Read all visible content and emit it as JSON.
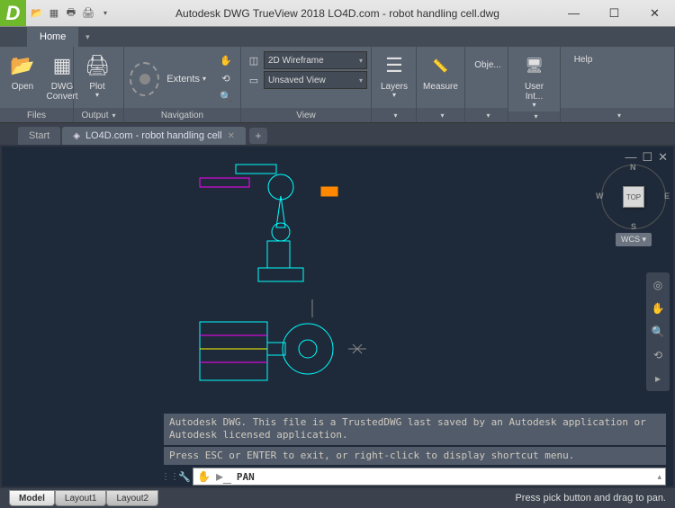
{
  "title": "Autodesk DWG TrueView 2018     LO4D.com - robot handling cell.dwg",
  "ribbon_tabs": [
    "Home"
  ],
  "panels": {
    "files": {
      "title": "Files",
      "open": "Open",
      "convert": "DWG\nConvert"
    },
    "output": {
      "title": "Output",
      "plot": "Plot"
    },
    "navigation": {
      "title": "Navigation",
      "extents": "Extents"
    },
    "view": {
      "title": "View",
      "visual_style": "2D Wireframe",
      "named_view": "Unsaved View"
    },
    "layers": {
      "title": "",
      "label": "Layers"
    },
    "measure": {
      "title": "",
      "label": "Measure"
    },
    "objects": {
      "title": "",
      "label": "Obje..."
    },
    "ui": {
      "title": "",
      "label": "User Int..."
    },
    "help": {
      "title": "",
      "label": "Help"
    }
  },
  "doc_tabs": [
    {
      "label": "Start",
      "active": false,
      "closeable": false
    },
    {
      "label": "LO4D.com - robot handling cell",
      "active": true,
      "closeable": true
    }
  ],
  "viewcube": {
    "face": "TOP",
    "n": "N",
    "s": "S",
    "e": "E",
    "w": "W",
    "wcs": "WCS"
  },
  "console": {
    "log1": "Autodesk DWG.  This file is a TrustedDWG last saved by an Autodesk application or Autodesk licensed application.",
    "log2": "Press ESC or ENTER to exit, or right-click to display shortcut menu.",
    "cmd": "PAN"
  },
  "layout_tabs": [
    "Model",
    "Layout1",
    "Layout2"
  ],
  "status_text": "Press pick button and drag to pan."
}
